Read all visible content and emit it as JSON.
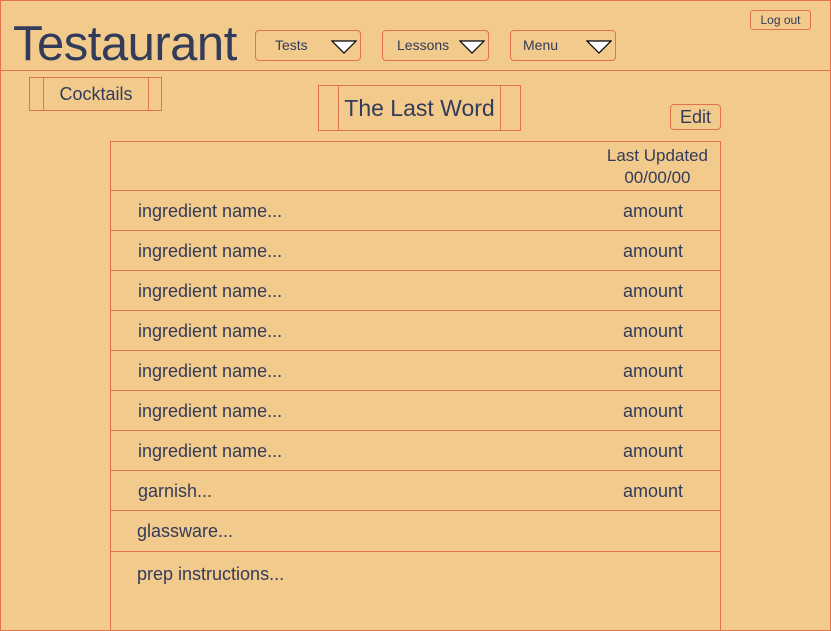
{
  "header": {
    "app_title": "Testaurant",
    "nav": [
      {
        "label": "Tests"
      },
      {
        "label": "Lessons"
      },
      {
        "label": "Menu"
      }
    ],
    "logout_label": "Log out"
  },
  "breadcrumb": {
    "label": "Cocktails"
  },
  "recipe": {
    "title": "The Last Word",
    "edit_label": "Edit",
    "last_updated_label": "Last Updated",
    "last_updated_value": "00/00/00",
    "ingredients": [
      {
        "name": "ingredient name...",
        "amount": "amount"
      },
      {
        "name": "ingredient name...",
        "amount": "amount"
      },
      {
        "name": "ingredient name...",
        "amount": "amount"
      },
      {
        "name": "ingredient name...",
        "amount": "amount"
      },
      {
        "name": "ingredient name...",
        "amount": "amount"
      },
      {
        "name": "ingredient name...",
        "amount": "amount"
      },
      {
        "name": "ingredient name...",
        "amount": "amount"
      }
    ],
    "garnish": {
      "name": "garnish...",
      "amount": "amount"
    },
    "glassware": "glassware...",
    "prep": "prep instructions..."
  },
  "colors": {
    "background": "#F2CA8C",
    "border": "#E2714F",
    "text": "#323B5A"
  }
}
